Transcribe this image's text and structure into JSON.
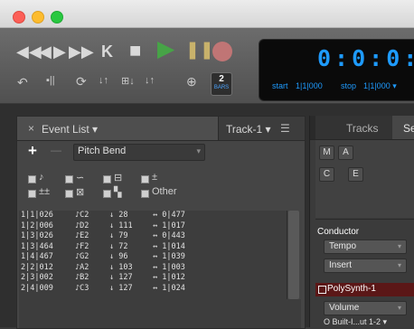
{
  "transport": {
    "row1": [
      "◀◀",
      "◀",
      "▶",
      "▶▶",
      "K",
      "■",
      "▶",
      "❚❚",
      "●"
    ],
    "row2": [
      "↶",
      "▪||",
      "⟳",
      "↓↑",
      "⊞↓",
      "↓↑",
      "⊕"
    ],
    "bars_value": "2",
    "bars_unit": "BARS",
    "counter_time": "0:0:0:",
    "start_label": "start",
    "start_value": "1|1|000",
    "stop_label": "stop",
    "stop_value": "1|1|000 ▾"
  },
  "event_list": {
    "close": "×",
    "title": "Event List ▾",
    "track": "Track-1 ▾",
    "menu": "☰",
    "add": "+",
    "remove": "—",
    "filter_value": "Pitch Bend",
    "filter_arrow": "▾",
    "filters_row1": [
      "♪",
      "∽",
      "⊟",
      "±"
    ],
    "filters_row2": [
      "±±",
      "⊠",
      "▚",
      "Other"
    ],
    "rows": [
      {
        "pos": "1|1|026",
        "note": "♪C2",
        "vel": "28",
        "len": "0|477"
      },
      {
        "pos": "1|2|006",
        "note": "♪D2",
        "vel": "111",
        "len": "1|017"
      },
      {
        "pos": "1|3|026",
        "note": "♪E2",
        "vel": "79",
        "len": "0|443"
      },
      {
        "pos": "1|3|464",
        "note": "♪F2",
        "vel": "72",
        "len": "1|014"
      },
      {
        "pos": "1|4|467",
        "note": "♪G2",
        "vel": "96",
        "len": "1|039"
      },
      {
        "pos": "2|2|012",
        "note": "♪A2",
        "vel": "103",
        "len": "1|003"
      },
      {
        "pos": "2|3|002",
        "note": "♪B2",
        "vel": "127",
        "len": "1|012"
      },
      {
        "pos": "2|4|009",
        "note": "♪C3",
        "vel": "127",
        "len": "1|024"
      }
    ]
  },
  "right_panel": {
    "tab_tracks": "Tracks",
    "tab_se": "Se",
    "btn_m": "M",
    "btn_a": "A",
    "btn_c": "C",
    "btn_e": "E",
    "conductor": "Conductor",
    "tempo": "Tempo",
    "insert": "Insert",
    "polysynth": "PolySynth-1",
    "volume": "Volume",
    "output": "O Built-I...ut 1-2 ▾"
  },
  "colors": {
    "counter_blue": "#1e9bff",
    "play_green": "#47a447",
    "record_red": "#c07575"
  }
}
